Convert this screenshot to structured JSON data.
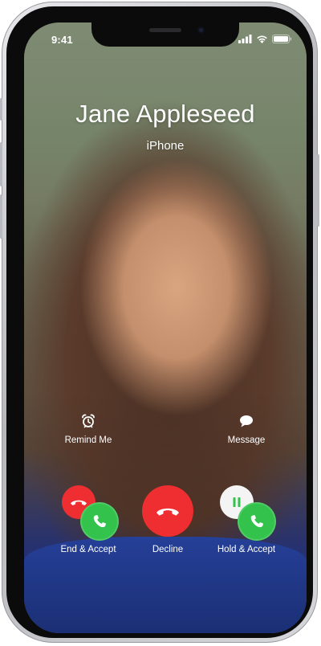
{
  "status_bar": {
    "time": "9:41"
  },
  "caller": {
    "name": "Jane Appleseed",
    "subtitle": "iPhone"
  },
  "actions": {
    "remind_me": {
      "label": "Remind Me",
      "icon": "alarm-clock-icon"
    },
    "message": {
      "label": "Message",
      "icon": "speech-bubble-icon"
    }
  },
  "call_buttons": {
    "end_accept": {
      "label": "End & Accept"
    },
    "decline": {
      "label": "Decline"
    },
    "hold_accept": {
      "label": "Hold & Accept"
    }
  },
  "colors": {
    "decline_red": "#ee2e30",
    "accept_green": "#33c24b",
    "hold_white": "#f4f4f4"
  }
}
